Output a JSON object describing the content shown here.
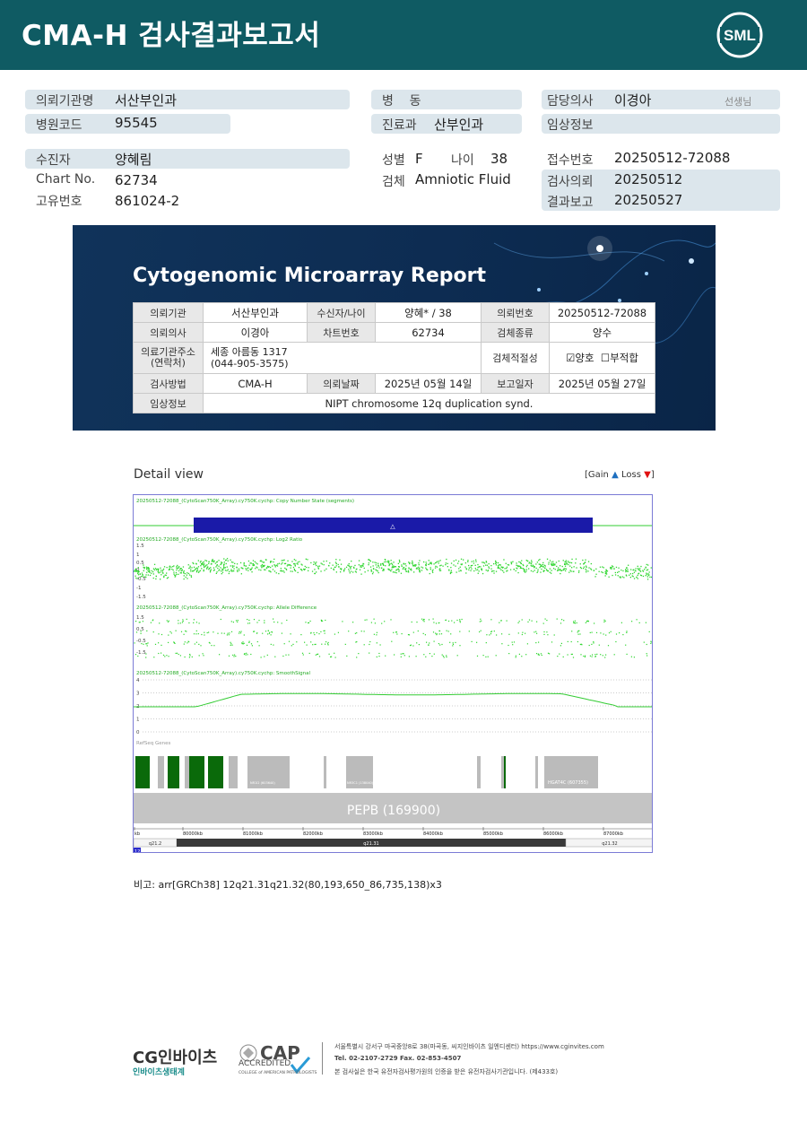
{
  "header": {
    "title": "CMA-H 검사결과보고서",
    "logo_text": "SML"
  },
  "info": {
    "inst_label": "의뢰기관명",
    "inst_value": "서산부인과",
    "code_label": "병원코드",
    "code_value": "95545",
    "patient_label": "수진자",
    "patient_value": "양혜림",
    "chart_label": "Chart No.",
    "chart_value": "62734",
    "uid_label": "고유번호",
    "uid_value": "861024-2",
    "ward_label": "병    동",
    "dept_label": "진료과",
    "dept_value": "산부인과",
    "sex_label": "성별",
    "sex_value": "F",
    "age_label": "나이",
    "age_value": "38",
    "specimen_label": "검체",
    "specimen_value": "Amniotic Fluid",
    "doctor_label": "담당의사",
    "doctor_value": "이경아",
    "doctor_suffix": "선생님",
    "clinical_label": "임상정보",
    "receipt_label": "접수번호",
    "receipt_value": "20250512-72088",
    "request_label": "검사의뢰",
    "request_value": "20250512",
    "result_label": "결과보고",
    "result_value": "20250527"
  },
  "report": {
    "title": "Cytogenomic Microarray Report",
    "r1": {
      "h1": "의뢰기관",
      "v1": "서산부인과",
      "h2": "수신자/나이",
      "v2": "양혜* / 38",
      "h3": "의뢰번호",
      "v3": "20250512-72088"
    },
    "r2": {
      "h1": "의뢰의사",
      "v1": "이경아",
      "h2": "차트번호",
      "v2": "62734",
      "h3": "검체종류",
      "v3": "양수"
    },
    "r3": {
      "h1a": "의료기관주소",
      "h1b": "(연락처)",
      "v1a": "세종 아름동 1317",
      "v1b": "(044-905-3575)",
      "h3": "검체적절성",
      "ok": "양호",
      "bad": "부적합"
    },
    "r4": {
      "h1": "검사방법",
      "v1": "CMA-H",
      "h2": "의뢰날짜",
      "v2": "2025년 05월 14일",
      "h3": "보고일자",
      "v3": "2025년 05월 27일"
    },
    "r5": {
      "h1": "임상정보",
      "v1": "NIPT chromosome 12q duplication synd."
    }
  },
  "detail": {
    "title": "Detail view",
    "legend_prefix": "[Gain",
    "legend_mid": "Loss",
    "legend_suffix": "]",
    "track1": "20250512-72088_(CytoScan750K_Array).cy750K.cychp: Copy Number State (segments)",
    "track2": "20250512-72088_(CytoScan750K_Array).cy750K.cychp: Log2 Ratio",
    "track3": "20250512-72088_(CytoScan750K_Array).cy750K.cychp: Allele Difference",
    "track4": "20250512-72088_(CytoScan750K_Array).cy750K.cychp: SmoothSignal",
    "track5": "RefSeq Genes",
    "gene_big": "PEPB (169900)",
    "gene_a": "NR1I2 (603640)",
    "gene_b": "NR3C1 (138040)",
    "gene_c": "HGAT4C (607355)",
    "ticks": [
      "kb",
      "80000kb",
      "81000kb",
      "82000kb",
      "83000kb",
      "84000kb",
      "85000kb",
      "86000kb",
      "87000kb"
    ],
    "band_left": "q21.2",
    "band_mid": "q21.31",
    "band_right": "q21.32",
    "chrom": "12"
  },
  "remark": {
    "label": "비고:",
    "text": "arr[GRCh38] 12q21.31q21.32(80,193,650_86,735,138)x3"
  },
  "footer": {
    "brand": "CG인바이츠",
    "brand_sub": "인바이츠생태계",
    "cap": "CAP",
    "cap_acc": "ACCREDITED",
    "cap_college": "COLLEGE of AMERICAN PATHOLOGISTS",
    "addr": "서울특별시 강서구 마곡중앙8로 38(마곡동, 씨지인바이츠 일엔디센터)  https://www.cginvites.com",
    "tel": "Tel. 02-2107-2729   Fax. 02-853-4507",
    "cert": "본 검사실은 한국 유전자검사평가원의 인증을 받은 유전자검사기관입니다. (제433호)"
  }
}
